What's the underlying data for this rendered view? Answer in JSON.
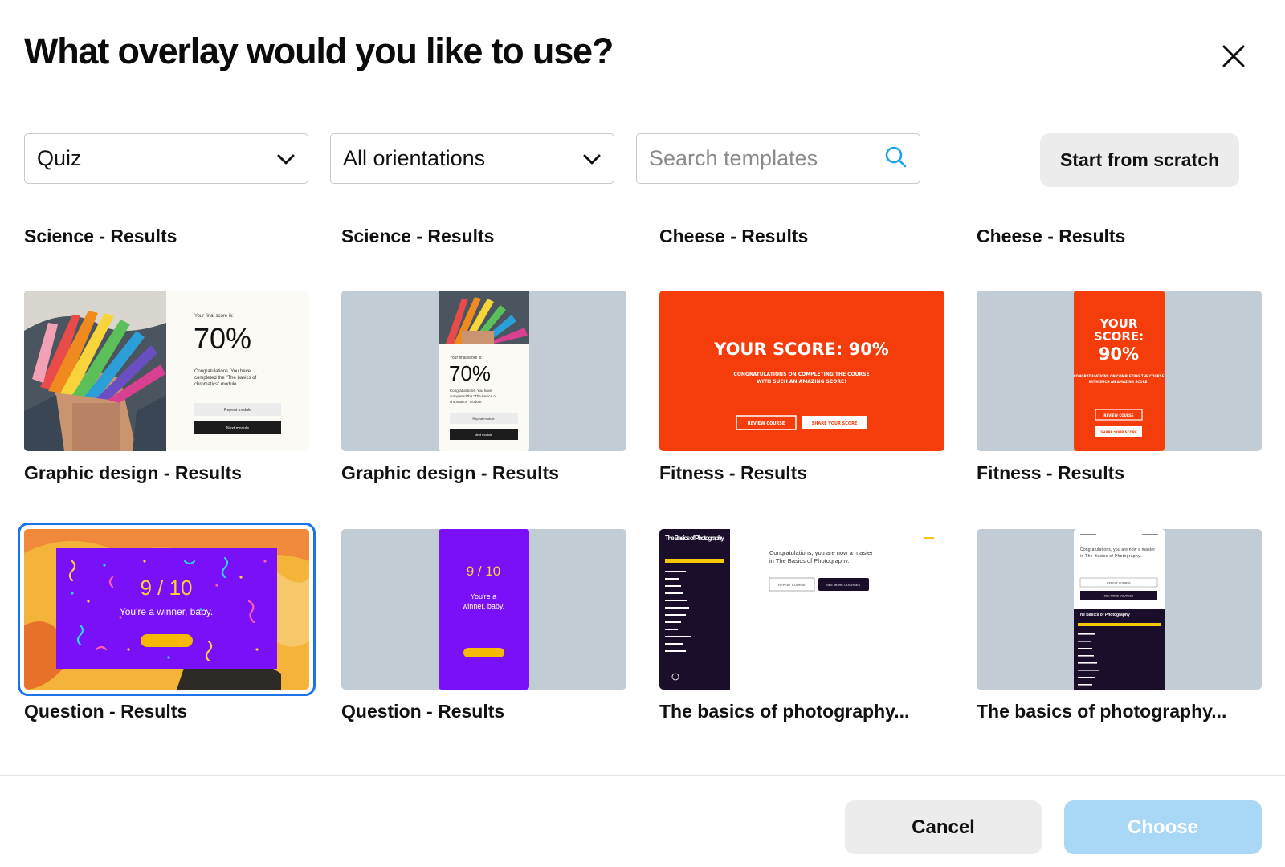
{
  "dialog": {
    "title": "What overlay would you like to use?"
  },
  "filters": {
    "category": {
      "selected": "Quiz"
    },
    "orientation": {
      "selected": "All orientations"
    },
    "search": {
      "placeholder": "Search templates",
      "value": ""
    }
  },
  "actions": {
    "start_from_scratch": "Start from scratch"
  },
  "top_row_labels": [
    "Science - Results",
    "Science - Results",
    "Cheese - Results",
    "Cheese - Results"
  ],
  "templates": [
    {
      "name": "Graphic design - Results"
    },
    {
      "name": "Graphic design - Results"
    },
    {
      "name": "Fitness - Results"
    },
    {
      "name": "Fitness - Results"
    },
    {
      "name": "Question - Results",
      "selected": true
    },
    {
      "name": "Question - Results"
    },
    {
      "name": "The basics of photography..."
    },
    {
      "name": "The basics of photography..."
    }
  ],
  "previews": {
    "gd_score_prompt": "Your final score is:",
    "gd_score": "70%",
    "gd_message_1": "Congratulations. You have",
    "gd_message_2": "completed the \"The basics of",
    "gd_message_3": "chromatics\" module.",
    "gd_repeat": "Repeat module",
    "gd_next": "Next module",
    "fit_score": "YOUR SCORE: 90%",
    "fit_score_l1": "YOUR",
    "fit_score_l2": "SCORE:",
    "fit_score_l3": "90%",
    "fit_message_1": "CONGRATULATIONS ON COMPLETING THE COURSE",
    "fit_message_2": "WITH SUCH AN AMAZING SCORE!",
    "fit_review": "REVIEW COURSE",
    "fit_share": "SHARE YOUR SCORE",
    "q_score": "9 / 10",
    "q_message": "You're a winner, baby.",
    "q_message_l1": "You're a",
    "q_message_l2": "winner, baby.",
    "ph_course": "The Basics of Photography",
    "ph_message_1": "Congratulations, you are now a master",
    "ph_message_2": "in The Basics of Photography.",
    "ph_repeat": "REPEAT COURSE",
    "ph_more": "SEE MORE COURSES"
  },
  "footer": {
    "cancel": "Cancel",
    "choose": "Choose"
  },
  "colors": {
    "selected_outline": "#1a73e8",
    "choose_disabled": "#a8d8f5",
    "fitness_orange": "#f53d0c",
    "question_purple": "#7a10f7",
    "thumb_gray": "#c2ccd5"
  }
}
